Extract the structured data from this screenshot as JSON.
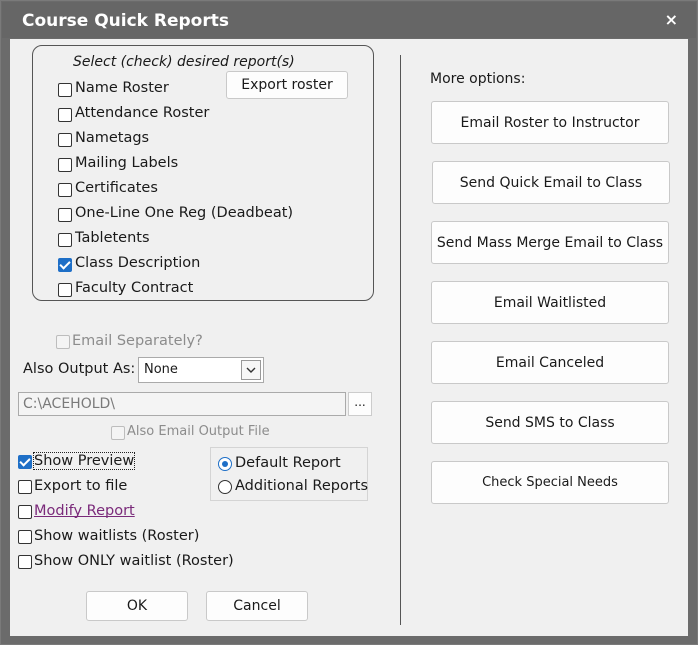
{
  "window": {
    "title": "Course Quick Reports",
    "close_symbol": "×"
  },
  "reports": {
    "group_title": "Select (check) desired report(s)",
    "export_roster_label": "Export roster",
    "items": [
      {
        "label": "Name Roster",
        "checked": false
      },
      {
        "label": "Attendance Roster",
        "checked": false
      },
      {
        "label": "Nametags",
        "checked": false
      },
      {
        "label": "Mailing Labels",
        "checked": false
      },
      {
        "label": "Certificates",
        "checked": false
      },
      {
        "label": "One-Line One Reg (Deadbeat)",
        "checked": false
      },
      {
        "label": "Tabletents",
        "checked": false
      },
      {
        "label": "Class Description",
        "checked": true
      },
      {
        "label": "Faculty Contract",
        "checked": false
      }
    ]
  },
  "options": {
    "email_separately": {
      "label": "Email Separately?",
      "checked": false,
      "enabled": false
    },
    "also_output_as": {
      "label": "Also Output As:",
      "value": "None"
    },
    "output_path": {
      "value": "C:\\ACEHOLD\\",
      "browse_label": "..."
    },
    "also_email_output": {
      "label": "Also Email Output File",
      "checked": false,
      "enabled": false
    },
    "show_preview": {
      "label": "Show Preview",
      "checked": true
    },
    "export_to_file": {
      "label": "Export to file",
      "checked": false
    },
    "modify_report": {
      "label": "Modify Report",
      "checked": false
    },
    "show_waitlists": {
      "label": "Show waitlists (Roster)",
      "checked": false
    },
    "show_only_waitlist": {
      "label": "Show ONLY waitlist (Roster)",
      "checked": false
    },
    "report_type": {
      "default_label": "Default Report",
      "additional_label": "Additional Reports",
      "selected": "default"
    }
  },
  "footer": {
    "ok_label": "OK",
    "cancel_label": "Cancel"
  },
  "more_options": {
    "title": "More options:",
    "buttons": [
      "Email Roster to Instructor",
      "Send Quick Email to Class",
      "Send Mass Merge Email to Class",
      "Email Waitlisted",
      "Email Canceled",
      "Send SMS to Class",
      "Check Special Needs"
    ]
  },
  "colors": {
    "title_bar": "#666666",
    "accent": "#1e6fc7",
    "link": "#7a2a7a"
  }
}
